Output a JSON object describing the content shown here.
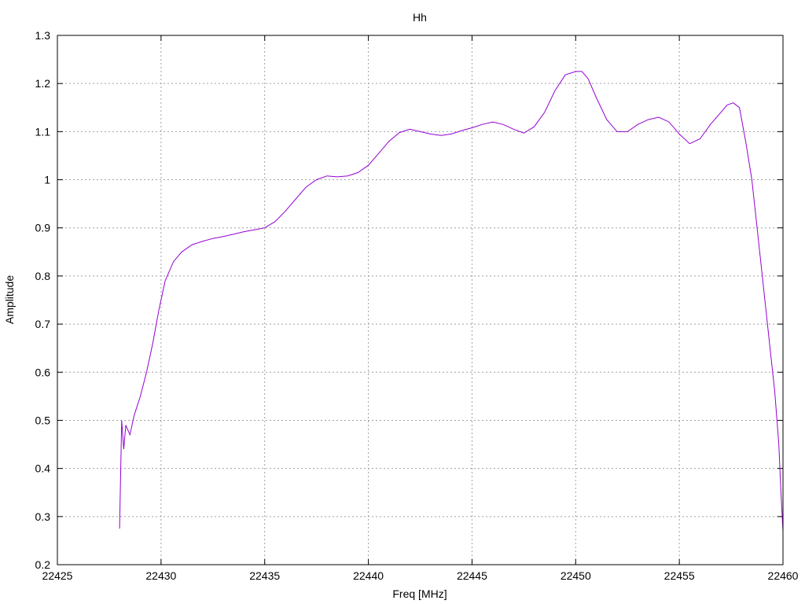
{
  "chart_data": {
    "type": "line",
    "title": "Hh",
    "xlabel": "Freq [MHz]",
    "ylabel": "Amplitude",
    "xlim": [
      22425,
      22460
    ],
    "ylim": [
      0.2,
      1.3
    ],
    "xticks": [
      22425,
      22430,
      22435,
      22440,
      22445,
      22450,
      22455,
      22460
    ],
    "yticks": [
      0.2,
      0.3,
      0.4,
      0.5,
      0.6,
      0.7,
      0.8,
      0.9,
      1,
      1.1,
      1.2,
      1.3
    ],
    "xtick_labels": [
      "22425",
      "22430",
      "22435",
      "22440",
      "22445",
      "22450",
      "22455",
      "22460"
    ],
    "ytick_labels": [
      "0.2",
      "0.3",
      "0.4",
      "0.5",
      "0.6",
      "0.7",
      "0.8",
      "0.9",
      "1",
      "1.1",
      "1.2",
      "1.3"
    ],
    "grid": true,
    "series": [
      {
        "color": "#9400d3",
        "x": [
          22428.0,
          22428.1,
          22428.2,
          22428.3,
          22428.5,
          22428.7,
          22429.0,
          22429.3,
          22429.6,
          22429.9,
          22430.2,
          22430.6,
          22431.0,
          22431.5,
          22432.0,
          22432.5,
          22433.0,
          22433.5,
          22434.0,
          22434.5,
          22435.0,
          22435.5,
          22436.0,
          22436.5,
          22437.0,
          22437.5,
          22438.0,
          22438.5,
          22439.0,
          22439.5,
          22440.0,
          22440.5,
          22441.0,
          22441.5,
          22442.0,
          22442.5,
          22443.0,
          22443.5,
          22444.0,
          22444.5,
          22445.0,
          22445.5,
          22446.0,
          22446.5,
          22447.0,
          22447.5,
          22448.0,
          22448.5,
          22449.0,
          22449.5,
          22450.0,
          22450.3,
          22450.6,
          22451.0,
          22451.5,
          22452.0,
          22452.5,
          22453.0,
          22453.5,
          22454.0,
          22454.5,
          22455.0,
          22455.5,
          22456.0,
          22456.5,
          22457.0,
          22457.3,
          22457.6,
          22457.9,
          22458.2,
          22458.5,
          22458.8,
          22459.1,
          22459.4,
          22459.6,
          22459.8,
          22459.9,
          22460.0
        ],
        "y": [
          0.275,
          0.5,
          0.44,
          0.49,
          0.47,
          0.51,
          0.55,
          0.6,
          0.66,
          0.73,
          0.79,
          0.83,
          0.85,
          0.865,
          0.872,
          0.878,
          0.882,
          0.887,
          0.892,
          0.896,
          0.9,
          0.913,
          0.935,
          0.96,
          0.985,
          1.0,
          1.008,
          1.006,
          1.008,
          1.015,
          1.03,
          1.055,
          1.08,
          1.098,
          1.105,
          1.1,
          1.095,
          1.092,
          1.095,
          1.102,
          1.108,
          1.115,
          1.12,
          1.115,
          1.105,
          1.097,
          1.11,
          1.14,
          1.185,
          1.218,
          1.225,
          1.225,
          1.21,
          1.17,
          1.125,
          1.1,
          1.1,
          1.115,
          1.125,
          1.13,
          1.12,
          1.095,
          1.075,
          1.085,
          1.115,
          1.14,
          1.155,
          1.16,
          1.15,
          1.08,
          1.0,
          0.88,
          0.76,
          0.64,
          0.56,
          0.45,
          0.35,
          0.27
        ]
      }
    ]
  }
}
